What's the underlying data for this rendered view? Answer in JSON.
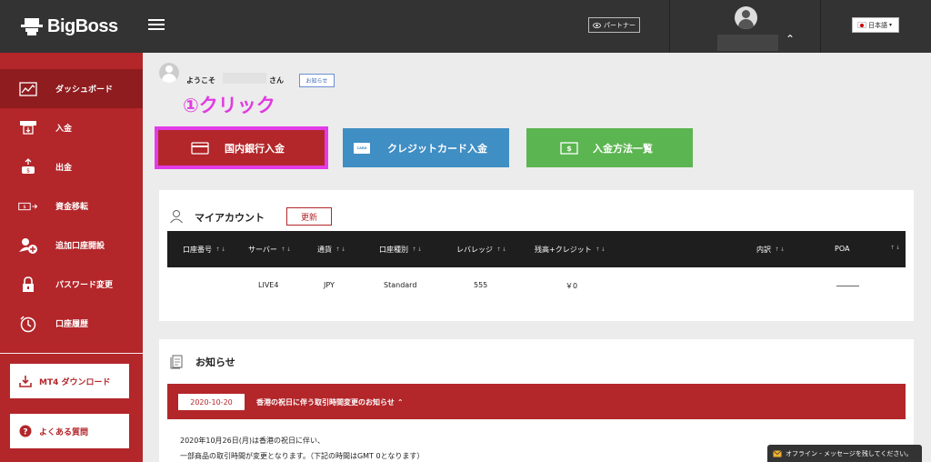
{
  "header": {
    "logo_text": "BigBoss",
    "partner_label": "パートナー",
    "language": "日本語"
  },
  "sidebar": {
    "items": [
      {
        "label": "ダッシュボード",
        "icon": "chart-icon"
      },
      {
        "label": "入金",
        "icon": "deposit-icon"
      },
      {
        "label": "出金",
        "icon": "withdraw-icon"
      },
      {
        "label": "資金移転",
        "icon": "transfer-icon"
      },
      {
        "label": "追加口座開設",
        "icon": "add-account-icon"
      },
      {
        "label": "パスワード変更",
        "icon": "lock-icon"
      },
      {
        "label": "口座履歴",
        "icon": "history-icon"
      }
    ],
    "mt4_download": "MT4 ダウンロード",
    "faq": "よくある質問"
  },
  "welcome": {
    "prefix": "ようこそ",
    "suffix": "さん",
    "notice_link": "お知らせ"
  },
  "annotation": "①クリック",
  "actions": {
    "domestic_bank": "国内銀行入金",
    "credit_card": "クレジットカード入金",
    "methods": "入金方法一覧"
  },
  "account_panel": {
    "title": "マイアカウント",
    "refresh_label": "更新",
    "columns": [
      "口座番号",
      "サーバー",
      "通貨",
      "口座種別",
      "レバレッジ",
      "残高+クレジット",
      "内訳",
      "POA"
    ],
    "rows": [
      {
        "account": "",
        "server": "LIVE4",
        "currency": "JPY",
        "type": "Standard",
        "leverage": "555",
        "balance": "￥0",
        "detail": "",
        "poa": ""
      }
    ]
  },
  "news_panel": {
    "title": "お知らせ",
    "date": "2020-10-20",
    "headline": "香港の祝日に伴う取引時間変更のお知らせ",
    "body_lines": [
      "2020年10月26日(月)は香港の祝日に伴い、",
      "一部商品の取引時間が変更となります。（下記の時間はGMT 0となります）"
    ]
  },
  "chat": {
    "label": "オフライン - メッセージを残してください。"
  },
  "colors": {
    "header_bg": "#333333",
    "sidebar_bg": "#b3262a",
    "accent_red": "#b3262a",
    "blue": "#3f8ec4",
    "green": "#5bb550",
    "annotation": "#e03be0"
  }
}
